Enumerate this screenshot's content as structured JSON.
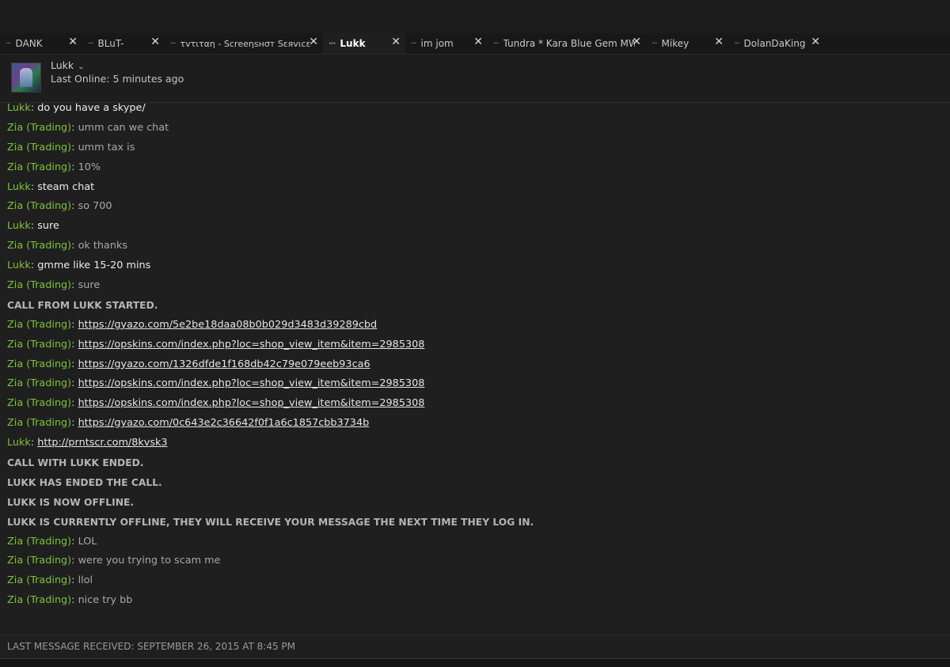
{
  "tabs": [
    {
      "label": "DANK",
      "active": false
    },
    {
      "label": "BLuT-",
      "active": false
    },
    {
      "label": "τvτιταη - Sc‌rееηsнσт Sεяvιcε",
      "active": false
    },
    {
      "label": "Lukk",
      "active": true
    },
    {
      "label": "im jom",
      "active": false
    },
    {
      "label": "Tundra * Kara Blue Gem MW",
      "active": false
    },
    {
      "label": "Mikey",
      "active": false
    },
    {
      "label": "DolanDaKing",
      "active": false
    }
  ],
  "icons": {
    "tab_menu": "ellipsis-icon",
    "tab_close": "close-icon",
    "dropdown": "chevron-down-icon"
  },
  "glyphs": {
    "dots": "···",
    "close": "✕",
    "chevron": "⌄"
  },
  "header": {
    "name": "Lukk",
    "status": "Last Online: 5 minutes ago"
  },
  "messages": [
    {
      "type": "lukk",
      "sender": "Lukk",
      "text": "do you have a skype/"
    },
    {
      "type": "zia",
      "sender": "Zia (Trading)",
      "text": "umm can we chat"
    },
    {
      "type": "zia",
      "sender": "Zia (Trading)",
      "text": "umm tax is"
    },
    {
      "type": "zia",
      "sender": "Zia (Trading)",
      "text": "10%"
    },
    {
      "type": "lukk",
      "sender": "Lukk",
      "text": "steam chat"
    },
    {
      "type": "zia",
      "sender": "Zia (Trading)",
      "text": "so 700"
    },
    {
      "type": "lukk",
      "sender": "Lukk",
      "text": "sure"
    },
    {
      "type": "zia",
      "sender": "Zia (Trading)",
      "text": "ok thanks"
    },
    {
      "type": "lukk",
      "sender": "Lukk",
      "text": "gmme like 15-20 mins"
    },
    {
      "type": "zia",
      "sender": "Zia (Trading)",
      "text": "sure"
    },
    {
      "type": "system",
      "text": "CALL FROM LUKK STARTED."
    },
    {
      "type": "zia",
      "sender": "Zia (Trading)",
      "link": "https://gyazo.com/5e2be18daa08b0b029d3483d39289cbd"
    },
    {
      "type": "zia",
      "sender": "Zia (Trading)",
      "link": "https://opskins.com/index.php?loc=shop_view_item&item=2985308"
    },
    {
      "type": "zia",
      "sender": "Zia (Trading)",
      "link": "https://gyazo.com/1326dfde1f168db42c79e079eeb93ca6"
    },
    {
      "type": "zia",
      "sender": "Zia (Trading)",
      "link": "https://opskins.com/index.php?loc=shop_view_item&item=2985308"
    },
    {
      "type": "zia",
      "sender": "Zia (Trading)",
      "link": "https://opskins.com/index.php?loc=shop_view_item&item=2985308"
    },
    {
      "type": "zia",
      "sender": "Zia (Trading)",
      "link": "https://gyazo.com/0c643e2c36642f0f1a6c1857cbb3734b"
    },
    {
      "type": "lukk",
      "sender": "Lukk",
      "link": "http://prntscr.com/8kvsk3"
    },
    {
      "type": "system",
      "text": "CALL WITH LUKK ENDED."
    },
    {
      "type": "system",
      "text": "LUKK HAS ENDED THE CALL."
    },
    {
      "type": "system",
      "text": "LUKK IS NOW OFFLINE."
    },
    {
      "type": "system",
      "text": "LUKK IS CURRENTLY OFFLINE, THEY WILL RECEIVE YOUR MESSAGE THE NEXT TIME THEY LOG IN."
    },
    {
      "type": "zia",
      "sender": "Zia (Trading)",
      "text": "LOL"
    },
    {
      "type": "zia",
      "sender": "Zia (Trading)",
      "text": "were you trying to scam me"
    },
    {
      "type": "zia",
      "sender": "Zia (Trading)",
      "text": "llol"
    },
    {
      "type": "zia",
      "sender": "Zia (Trading)",
      "text": "nice try bb"
    }
  ],
  "footer": {
    "last_message": "LAST MESSAGE RECEIVED: SEPTEMBER 26, 2015 AT 8:45 PM"
  },
  "colors": {
    "sender": "#7fc23a",
    "background": "#1f1f1f"
  }
}
